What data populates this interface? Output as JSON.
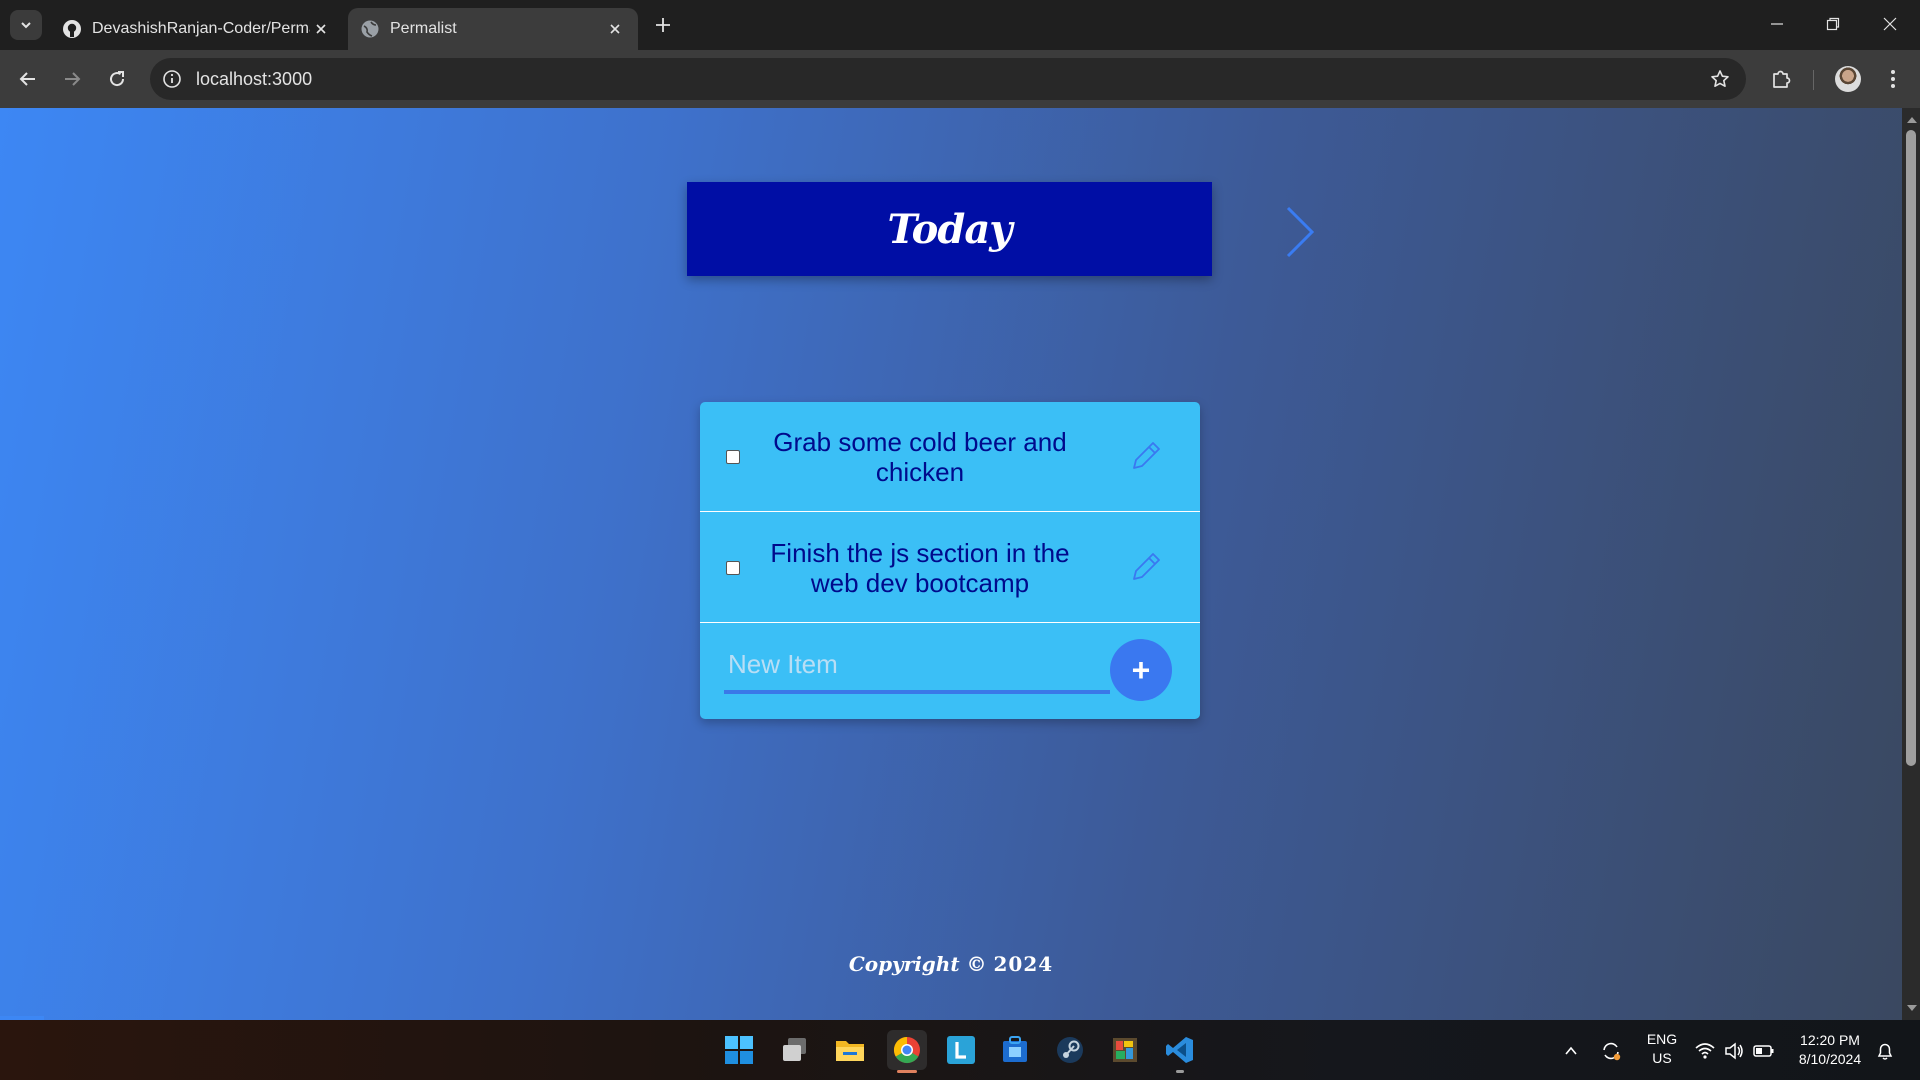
{
  "browser": {
    "tabs": [
      {
        "title": "DevashishRanjan-Coder/Permalist",
        "icon": "github-icon",
        "active": false
      },
      {
        "title": "Permalist",
        "icon": "globe-icon",
        "active": true
      }
    ],
    "url": "localhost:3000"
  },
  "page": {
    "heading": "Today",
    "items": [
      {
        "text": "Grab some cold beer and chicken",
        "checked": false
      },
      {
        "text": "Finish the js section in the web dev bootcamp",
        "checked": false
      }
    ],
    "new_item": {
      "placeholder": "New Item",
      "value": "",
      "add_label": "+"
    },
    "footer": {
      "copyright": "Copyright ©",
      "year": "2024"
    }
  },
  "colors": {
    "heading_bg": "#000ea5",
    "card_bg": "#3bbff6",
    "item_text": "#000a8c",
    "accent": "#3a78f0"
  },
  "taskbar": {
    "apps": [
      "windows-start-icon",
      "task-view-icon",
      "file-explorer-icon",
      "chrome-icon",
      "l-app-icon",
      "store-icon",
      "steam-icon",
      "paint-icon",
      "vscode-icon"
    ],
    "language": {
      "line1": "ENG",
      "line2": "US"
    },
    "time": "12:20 PM",
    "date": "8/10/2024"
  }
}
